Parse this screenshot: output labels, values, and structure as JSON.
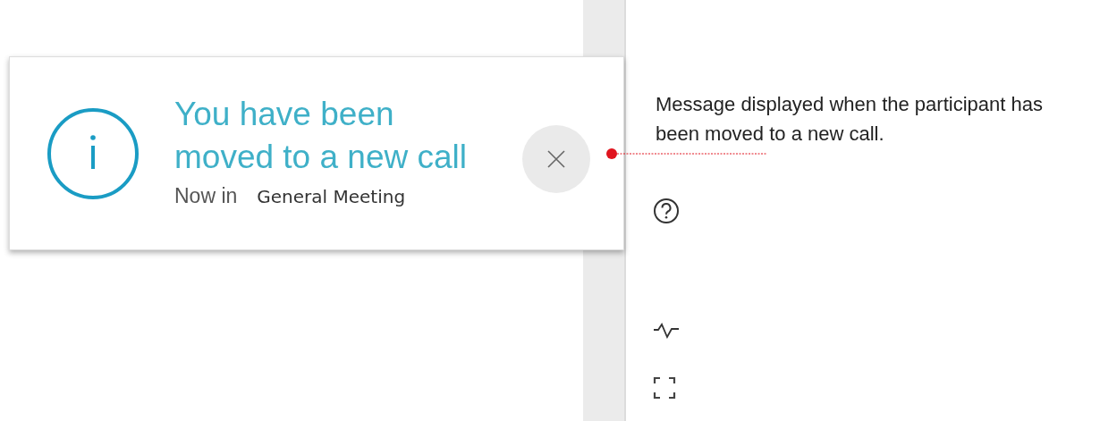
{
  "notification": {
    "title": "You have been moved to a new call",
    "label": "Now in",
    "meeting": "General Meeting"
  },
  "annotation": {
    "text": "Message displayed when the participant has been moved to a new call."
  }
}
